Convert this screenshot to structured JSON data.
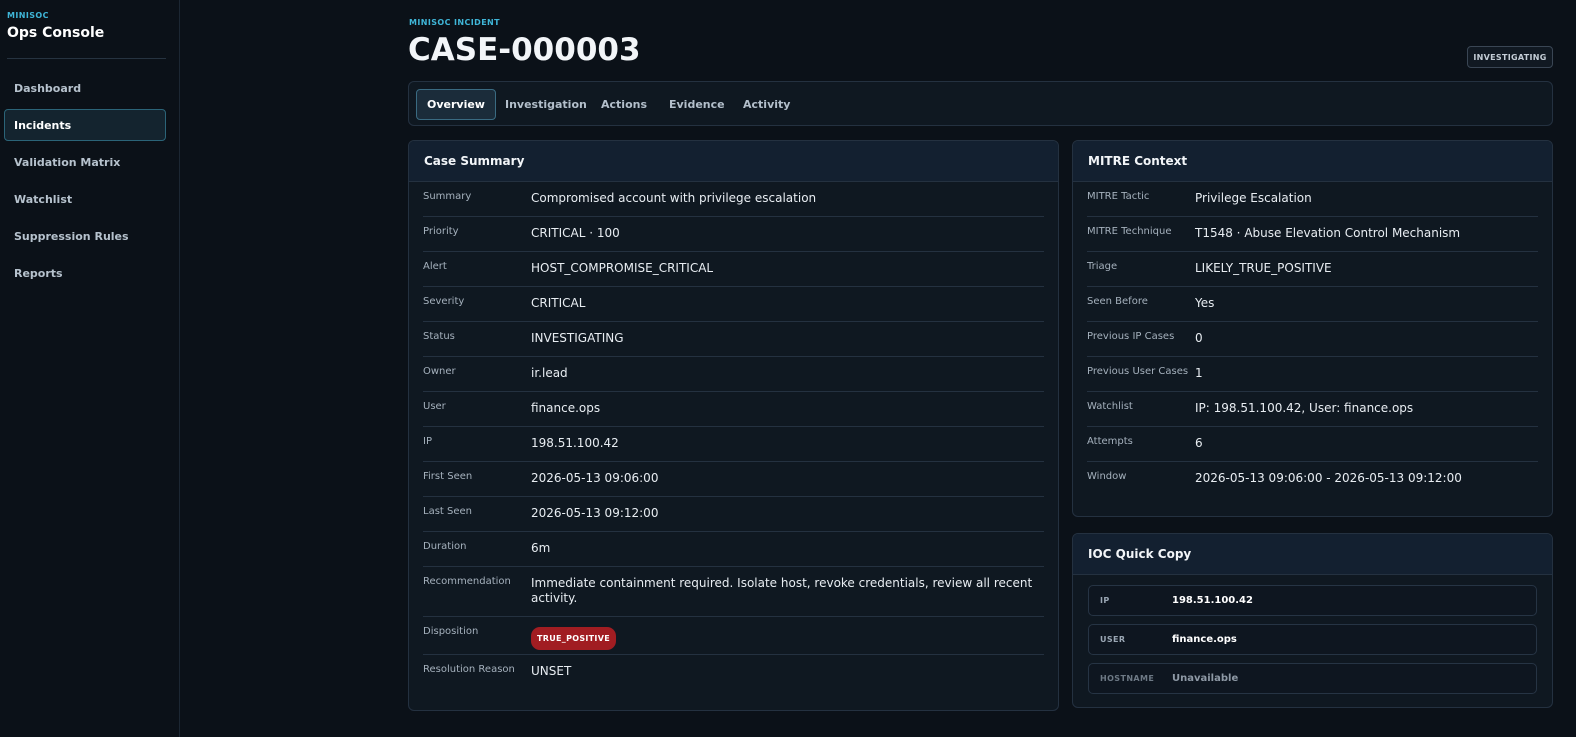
{
  "sidebar": {
    "brand_small": "MINISOC",
    "brand_title": "Ops Console",
    "items": [
      {
        "label": "Dashboard",
        "active": false
      },
      {
        "label": "Incidents",
        "active": true
      },
      {
        "label": "Validation Matrix",
        "active": false
      },
      {
        "label": "Watchlist",
        "active": false
      },
      {
        "label": "Suppression Rules",
        "active": false
      },
      {
        "label": "Reports",
        "active": false
      }
    ]
  },
  "header": {
    "eyebrow": "MINISOC INCIDENT",
    "title": "CASE-000003",
    "status": "INVESTIGATING"
  },
  "tabs": [
    {
      "label": "Overview",
      "active": true
    },
    {
      "label": "Investigation",
      "active": false
    },
    {
      "label": "Actions",
      "active": false
    },
    {
      "label": "Evidence",
      "active": false
    },
    {
      "label": "Activity",
      "active": false
    }
  ],
  "case_summary": {
    "title": "Case Summary",
    "rows": [
      {
        "key": "Summary",
        "value": "Compromised account with privilege escalation"
      },
      {
        "key": "Priority",
        "value": "CRITICAL · 100"
      },
      {
        "key": "Alert",
        "value": "HOST_COMPROMISE_CRITICAL"
      },
      {
        "key": "Severity",
        "value": "CRITICAL"
      },
      {
        "key": "Status",
        "value": "INVESTIGATING"
      },
      {
        "key": "Owner",
        "value": "ir.lead"
      },
      {
        "key": "User",
        "value": "finance.ops"
      },
      {
        "key": "IP",
        "value": "198.51.100.42"
      },
      {
        "key": "First Seen",
        "value": "2026-05-13 09:06:00"
      },
      {
        "key": "Last Seen",
        "value": "2026-05-13 09:12:00"
      },
      {
        "key": "Duration",
        "value": "6m"
      },
      {
        "key": "Recommendation",
        "value": "Immediate containment required. Isolate host, revoke credentials, review all recent activity."
      },
      {
        "key": "Disposition",
        "badge": "TRUE_POSITIVE"
      },
      {
        "key": "Resolution Reason",
        "value": "UNSET"
      }
    ]
  },
  "mitre": {
    "title": "MITRE Context",
    "rows": [
      {
        "key": "MITRE Tactic",
        "value": "Privilege Escalation"
      },
      {
        "key": "MITRE Technique",
        "value": "T1548 · Abuse Elevation Control Mechanism"
      },
      {
        "key": "Triage",
        "value": "LIKELY_TRUE_POSITIVE"
      },
      {
        "key": "Seen Before",
        "value": "Yes"
      },
      {
        "key": "Previous IP Cases",
        "value": "0"
      },
      {
        "key": "Previous User Cases",
        "value": "1"
      },
      {
        "key": "Watchlist",
        "value": "IP: 198.51.100.42, User: finance.ops"
      },
      {
        "key": "Attempts",
        "value": "6"
      },
      {
        "key": "Window",
        "value": "2026-05-13 09:06:00 - 2026-05-13 09:12:00"
      }
    ]
  },
  "ioc": {
    "title": "IOC Quick Copy",
    "items": [
      {
        "key": "IP",
        "value": "198.51.100.42"
      },
      {
        "key": "USER",
        "value": "finance.ops"
      },
      {
        "key": "HOSTNAME",
        "value": "Unavailable"
      }
    ]
  },
  "colors": {
    "accent": "#3fb6d8",
    "background": "#0b1118",
    "panel": "#0f1821",
    "badge_red": "#a11d22"
  }
}
